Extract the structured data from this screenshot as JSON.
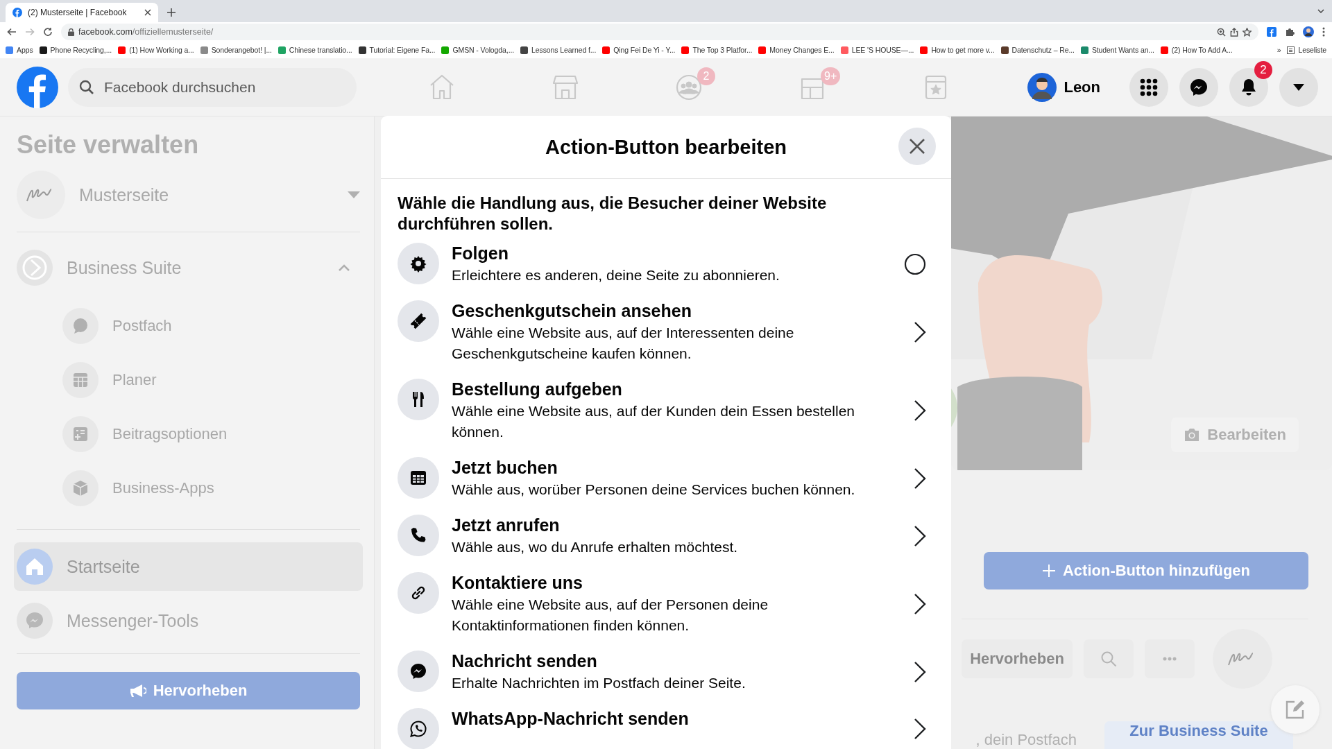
{
  "browser": {
    "tabs": [
      {
        "title": "(2) Musterseite | Facebook",
        "selected": true
      }
    ],
    "url_domain": "facebook.com",
    "url_path": "/offiziellemusterseite/",
    "bookmarks": [
      {
        "label": "Apps",
        "color": "#4285f4"
      },
      {
        "label": "Phone Recycling,...",
        "color": "#1a1a1a"
      },
      {
        "label": "(1) How Working a...",
        "color": "#ff0000"
      },
      {
        "label": "Sonderangebot! |...",
        "color": "#8a8a8a"
      },
      {
        "label": "Chinese translatio...",
        "color": "#1fa463"
      },
      {
        "label": "Tutorial: Eigene Fa...",
        "color": "#333333"
      },
      {
        "label": "GMSN - Vologda,...",
        "color": "#14a800"
      },
      {
        "label": "Lessons Learned f...",
        "color": "#444444"
      },
      {
        "label": "Qing Fei De Yi - Y...",
        "color": "#fe0000"
      },
      {
        "label": "The Top 3 Platfor...",
        "color": "#ff0101"
      },
      {
        "label": "Money Changes E...",
        "color": "#ff0202"
      },
      {
        "label": "LEE 'S HOUSE—...",
        "color": "#ff5a5f"
      },
      {
        "label": "How to get more v...",
        "color": "#ff0303"
      },
      {
        "label": "Datenschutz – Re...",
        "color": "#5a3a2a"
      },
      {
        "label": "Student Wants an...",
        "color": "#1b8a6b"
      },
      {
        "label": "(2) How To Add A...",
        "color": "#ff0404"
      }
    ],
    "bookmarks_more": "»",
    "reading_list": "Leseliste"
  },
  "header": {
    "search": {
      "placeholder": "Facebook durchsuchen"
    },
    "nav": [
      {
        "selected": false
      },
      {
        "selected": false
      },
      {
        "selected": false,
        "badge": "2"
      },
      {
        "selected": false,
        "badge": "9+"
      },
      {
        "selected": false
      }
    ],
    "user": {
      "name": "Leon"
    },
    "notifications_badge": "2"
  },
  "sidebar": {
    "title": "Seite verwalten",
    "page": {
      "name": "Musterseite"
    },
    "sections": [
      {
        "label": "Business Suite",
        "expanded": true,
        "children": [
          {
            "label": "Postfach"
          },
          {
            "label": "Planer"
          },
          {
            "label": "Beitragsoptionen"
          },
          {
            "label": "Business-Apps"
          }
        ]
      }
    ],
    "items": [
      {
        "label": "Startseite",
        "selected": true
      },
      {
        "label": "Messenger-Tools",
        "selected": false
      }
    ],
    "promote_button": "Hervorheben"
  },
  "page": {
    "edit_cover_button": "Bearbeiten",
    "action_button": "Action-Button hinzufügen",
    "promote_tab": "Hervorheben",
    "inbox_text": ", dein Postfach",
    "business_suite_button": "Zur Business Suite"
  },
  "modal": {
    "title": "Action-Button bearbeiten",
    "prompt": "Wähle die Handlung aus, die Besucher deiner Website durchführen sollen.",
    "options": [
      {
        "kind": "radio",
        "title": "Folgen",
        "description": "Erleichtere es anderen, deine Seite zu abonnieren.",
        "selected": false
      },
      {
        "kind": "link",
        "title": "Geschenkgutschein ansehen",
        "description": "Wähle eine Website aus, auf der Interessenten deine Geschenkgutscheine kaufen können."
      },
      {
        "kind": "link",
        "title": "Bestellung aufgeben",
        "description": "Wähle eine Website aus, auf der Kunden dein Essen bestellen können."
      },
      {
        "kind": "link",
        "title": "Jetzt buchen",
        "description": "Wähle aus, worüber Personen deine Services buchen können."
      },
      {
        "kind": "link",
        "title": "Jetzt anrufen",
        "description": "Wähle aus, wo du Anrufe erhalten möchtest."
      },
      {
        "kind": "link",
        "title": "Kontaktiere uns",
        "description": "Wähle eine Website aus, auf der Personen deine Kontaktinformationen finden können."
      },
      {
        "kind": "link",
        "title": "Nachricht senden",
        "description": "Erhalte Nachrichten im Postfach deiner Seite."
      },
      {
        "kind": "link",
        "title": "WhatsApp-Nachricht senden"
      }
    ]
  }
}
